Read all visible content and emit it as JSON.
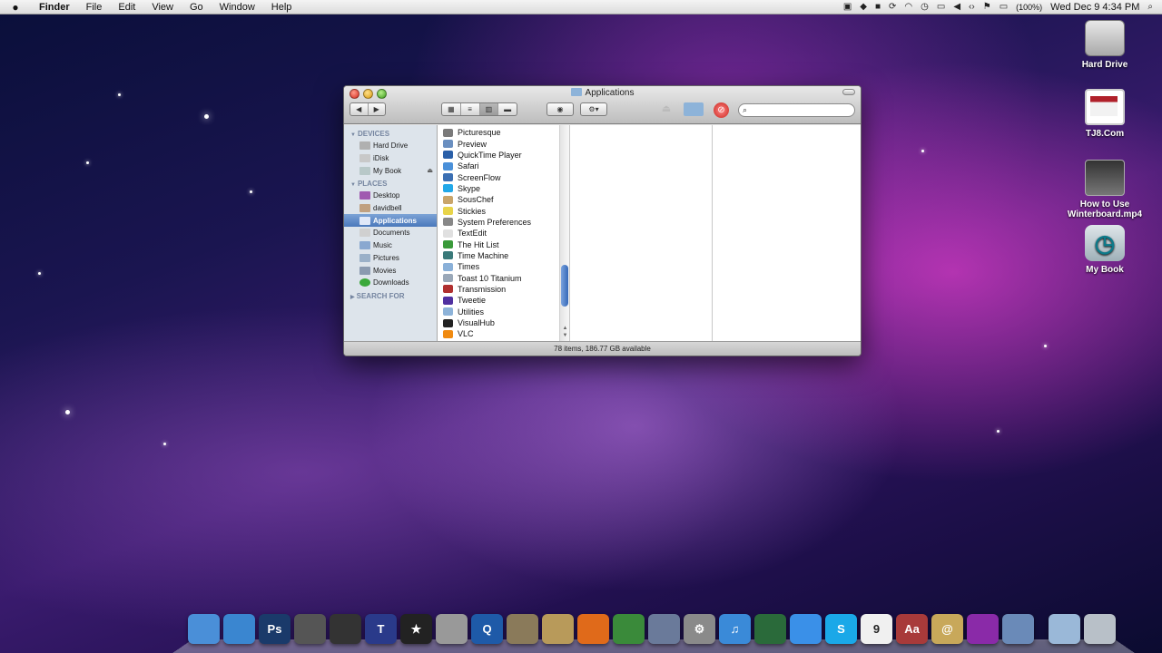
{
  "menubar": {
    "apple_icon": "apple-icon",
    "app_name": "Finder",
    "menus": [
      "File",
      "Edit",
      "View",
      "Go",
      "Window",
      "Help"
    ],
    "battery": "(100%)",
    "clock": "Wed Dec 9  4:34 PM"
  },
  "desktop_icons": [
    {
      "label": "Hard Drive",
      "icon": "hard-drive-icon"
    },
    {
      "label": "TJ8.Com",
      "icon": "webloc-icon"
    },
    {
      "label": "How to Use Winterboard.mp4",
      "icon": "movie-file-icon"
    },
    {
      "label": "My Book",
      "icon": "time-machine-drive-icon"
    }
  ],
  "finder": {
    "title": "Applications",
    "search_placeholder": "",
    "view_modes": [
      "icon",
      "list",
      "column",
      "coverflow"
    ],
    "active_view": "column",
    "sidebar": {
      "devices_header": "DEVICES",
      "devices": [
        "Hard Drive",
        "iDisk",
        "My Book"
      ],
      "places_header": "PLACES",
      "places": [
        "Desktop",
        "davidbell",
        "Applications",
        "Documents",
        "Music",
        "Pictures",
        "Movies",
        "Downloads"
      ],
      "selected": "Applications",
      "search_header": "SEARCH FOR"
    },
    "apps": [
      {
        "name": "Picturesque",
        "color": "#7a7a7a"
      },
      {
        "name": "Preview",
        "color": "#6a8fc0"
      },
      {
        "name": "QuickTime Player",
        "color": "#2a5fa8"
      },
      {
        "name": "Safari",
        "color": "#4a90d9"
      },
      {
        "name": "ScreenFlow",
        "color": "#3b6fb3"
      },
      {
        "name": "Skype",
        "color": "#22a8e8"
      },
      {
        "name": "SousChef",
        "color": "#c9a56a"
      },
      {
        "name": "Stickies",
        "color": "#e8d44a"
      },
      {
        "name": "System Preferences",
        "color": "#888888"
      },
      {
        "name": "TextEdit",
        "color": "#e0e0e0"
      },
      {
        "name": "The Hit List",
        "color": "#3a9a3a"
      },
      {
        "name": "Time Machine",
        "color": "#3a7a7a"
      },
      {
        "name": "Times",
        "color": "#8ab0d8"
      },
      {
        "name": "Toast 10 Titanium",
        "color": "#9aa8b8",
        "folder": true
      },
      {
        "name": "Transmission",
        "color": "#b03030"
      },
      {
        "name": "Tweetie",
        "color": "#5030a0"
      },
      {
        "name": "Utilities",
        "color": "#8db3d9",
        "folder": true
      },
      {
        "name": "VisualHub",
        "color": "#222222"
      },
      {
        "name": "VLC",
        "color": "#f08a10"
      }
    ],
    "status": "78 items, 186.77 GB available"
  },
  "dock": [
    {
      "name": "finder",
      "color": "#4a8fd8",
      "glyph": ""
    },
    {
      "name": "safari",
      "color": "#3a86d0",
      "glyph": ""
    },
    {
      "name": "photoshop",
      "color": "#1a3a6a",
      "glyph": "Ps"
    },
    {
      "name": "imovie",
      "color": "#555555",
      "glyph": ""
    },
    {
      "name": "final-cut",
      "color": "#333333",
      "glyph": ""
    },
    {
      "name": "typinator",
      "color": "#2a3a8a",
      "glyph": "T"
    },
    {
      "name": "imovie-star",
      "color": "#222222",
      "glyph": "★"
    },
    {
      "name": "photo-booth",
      "color": "#999999",
      "glyph": ""
    },
    {
      "name": "quicktime",
      "color": "#1e5aa8",
      "glyph": "Q"
    },
    {
      "name": "iphoto",
      "color": "#8a7a5a",
      "glyph": ""
    },
    {
      "name": "preview",
      "color": "#b89a5a",
      "glyph": ""
    },
    {
      "name": "keynote",
      "color": "#e06a1a",
      "glyph": ""
    },
    {
      "name": "numbers",
      "color": "#3a8a3a",
      "glyph": ""
    },
    {
      "name": "script-editor",
      "color": "#6a7a9a",
      "glyph": ""
    },
    {
      "name": "system-preferences",
      "color": "#8a8a8a",
      "glyph": "⚙"
    },
    {
      "name": "itunes",
      "color": "#3a8ad8",
      "glyph": "♫"
    },
    {
      "name": "dashboard",
      "color": "#2a6a3a",
      "glyph": ""
    },
    {
      "name": "ichat",
      "color": "#3a90e8",
      "glyph": ""
    },
    {
      "name": "skype",
      "color": "#1aa8e8",
      "glyph": "S"
    },
    {
      "name": "ical",
      "color": "#f0f0f0",
      "glyph": "9"
    },
    {
      "name": "dictionary",
      "color": "#a83a3a",
      "glyph": "Aa"
    },
    {
      "name": "address-book",
      "color": "#c8a85a",
      "glyph": "@"
    },
    {
      "name": "stack-app",
      "color": "#8a2aa8",
      "glyph": ""
    },
    {
      "name": "xcode",
      "color": "#6a8ab8",
      "glyph": ""
    },
    {
      "name": "applications-stack",
      "color": "#9ab8d8",
      "glyph": ""
    },
    {
      "name": "trash",
      "color": "#b8c0c8",
      "glyph": ""
    }
  ]
}
